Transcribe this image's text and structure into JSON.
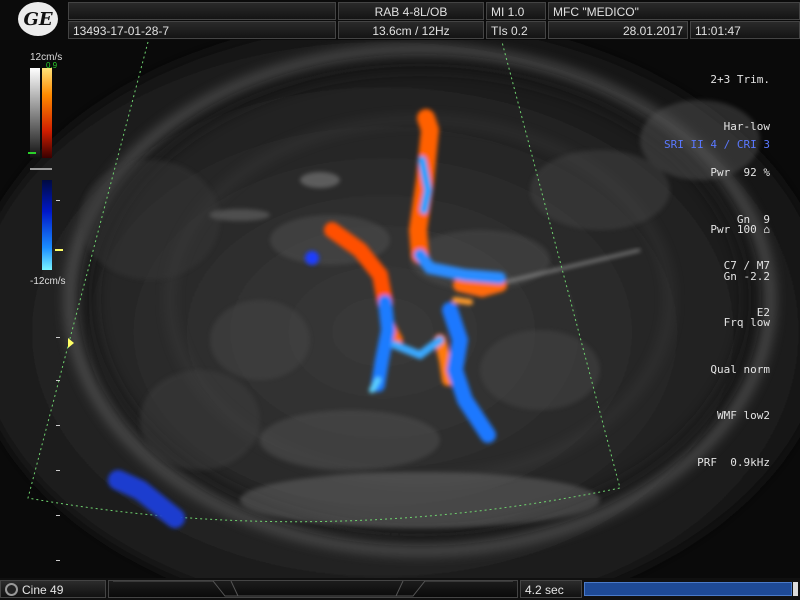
{
  "header": {
    "patient_id": "13493-17-01-28-7",
    "probe": "RAB 4-8L/OB",
    "depth_freq": "13.6cm / 12Hz",
    "mi": "MI  1.0",
    "tis": "TIs  0.2",
    "institution": "MFC \"MEDICO\"",
    "date": "28.01.2017",
    "time": "11:01:47"
  },
  "image_params": [
    "2+3 Trim.",
    "Har-low",
    "Pwr  92 %",
    "Gn  9",
    "C7 / M7",
    "E2"
  ],
  "sri_cri": "SRI II 4 / CRI 3",
  "color_params": [
    "Pwr 100 ⌂",
    "Gn -2.2",
    "Frq low",
    "Qual norm",
    "WMF low2",
    "PRF  0.9kHz"
  ],
  "colorbar": {
    "top_label": "12cm/s",
    "bottom_label": "-12cm/s",
    "small_tag": "0.9"
  },
  "footer": {
    "cine_label": "Cine 49",
    "duration": "4.2 sec"
  },
  "colors": {
    "doppler_red": "#ff5a00",
    "doppler_blue": "#1e78ff",
    "sector_line": "#6fd36f"
  }
}
